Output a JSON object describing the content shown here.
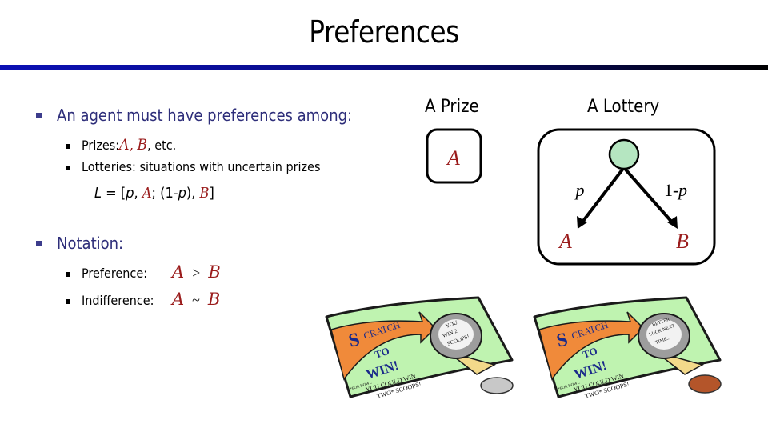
{
  "slide": {
    "title": "Preferences"
  },
  "bullets": {
    "main": "An agent must have preferences among:",
    "prizes_label": "Prizes:",
    "prizes_a": "A,",
    "prizes_b": "B",
    "prizes_suffix": ", etc.",
    "lotteries": "Lotteries: situations with uncertain prizes",
    "lottery_formula": {
      "lhs": "L",
      "eq": " = [",
      "p1": "p",
      "sep1": ", ",
      "a": "A",
      "sep2": ";  (1-",
      "p2": "p",
      "sep3": "), ",
      "b": "B",
      "close": "]"
    },
    "notation": "Notation:",
    "preference_label": "Preference:",
    "preference_a": "A",
    "preference_op": ">",
    "preference_b": "B",
    "indifference_label": "Indifference:",
    "indifference_a": "A",
    "indifference_op": "~",
    "indifference_b": "B"
  },
  "diagram": {
    "prize_heading": "A Prize",
    "prize_value": "A",
    "lottery_heading": "A Lottery",
    "left_prob": "p",
    "right_prob_prefix": "1-",
    "right_prob_var": "p",
    "left_outcome": "A",
    "right_outcome": "B",
    "node_color": "#b5e6c1",
    "outcome_color": "#9a1b1b"
  },
  "cards": [
    {
      "headline": [
        "S",
        "CRATCH",
        "TO",
        "WIN!"
      ],
      "subtext": [
        "YOU COULD WIN",
        "TWO* SCOOPS!"
      ],
      "scratch_result": [
        "YOU",
        "WIN 2",
        "SCOOPS!"
      ],
      "fine_print": "*FOR NOW...",
      "coin": "silver-coin"
    },
    {
      "headline": [
        "S",
        "CRATCH",
        "TO",
        "WIN!"
      ],
      "subtext": [
        "YOU COULD WIN",
        "TWO* SCOOPS!"
      ],
      "scratch_result": [
        "BETTER",
        "LUCK NEXT",
        "TIME..."
      ],
      "fine_print": "*FOR NOW...",
      "coin": "copper-coin"
    }
  ],
  "colors": {
    "bullet_text": "#2e2e7a",
    "math_red": "#9a1b1b",
    "card_green": "#bff3b0",
    "arrow_orange": "#f08a3a",
    "headline_blue": "#1a2a8a"
  }
}
